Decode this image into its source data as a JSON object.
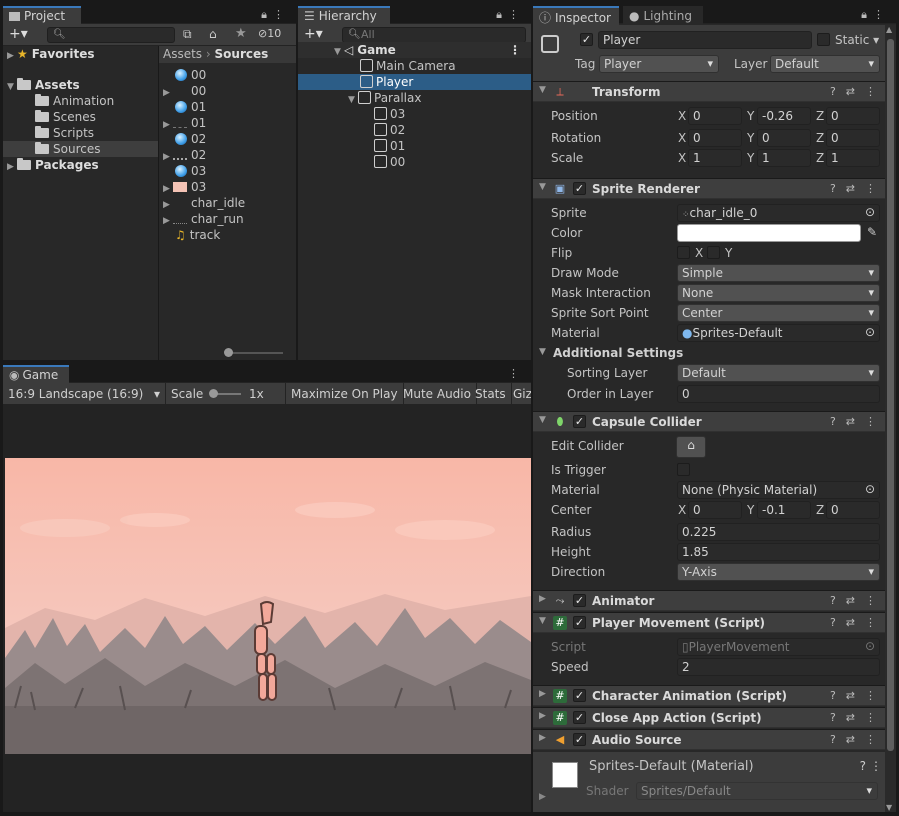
{
  "project": {
    "tab": "Project",
    "hidden_count": "10",
    "tree": [
      {
        "label": "Favorites",
        "kind": "favorites"
      },
      {
        "label": "Assets",
        "kind": "folder-open"
      },
      {
        "label": "Animation",
        "kind": "folder"
      },
      {
        "label": "Scenes",
        "kind": "folder"
      },
      {
        "label": "Scripts",
        "kind": "folder"
      },
      {
        "label": "Sources",
        "kind": "folder"
      },
      {
        "label": "Packages",
        "kind": "folder-root"
      }
    ],
    "breadcrumb": [
      "Assets",
      "Sources"
    ],
    "assets": [
      {
        "label": "00",
        "icon": "sprite-ball"
      },
      {
        "label": "00",
        "icon": "sprite-strip"
      },
      {
        "label": "01",
        "icon": "sprite-ball"
      },
      {
        "label": "01",
        "icon": "sprite-strip"
      },
      {
        "label": "02",
        "icon": "sprite-ball"
      },
      {
        "label": "02",
        "icon": "sprite-strip"
      },
      {
        "label": "03",
        "icon": "sprite-ball"
      },
      {
        "label": "03",
        "icon": "sprite-pink"
      },
      {
        "label": "char_idle",
        "icon": "sprite-char"
      },
      {
        "label": "char_run",
        "icon": "sprite-char"
      },
      {
        "label": "track",
        "icon": "audio-note"
      }
    ]
  },
  "hierarchy": {
    "tab": "Hierarchy",
    "search_placeholder": "All",
    "items": [
      {
        "label": "Game",
        "indent": 0,
        "kind": "scene"
      },
      {
        "label": "Main Camera",
        "indent": 1,
        "kind": "object"
      },
      {
        "label": "Player",
        "indent": 1,
        "kind": "object",
        "selected": true
      },
      {
        "label": "Parallax",
        "indent": 1,
        "kind": "object-parent"
      },
      {
        "label": "03",
        "indent": 2,
        "kind": "object"
      },
      {
        "label": "02",
        "indent": 2,
        "kind": "object"
      },
      {
        "label": "01",
        "indent": 2,
        "kind": "object"
      },
      {
        "label": "00",
        "indent": 2,
        "kind": "object"
      }
    ]
  },
  "game": {
    "tab": "Game",
    "aspect": "16:9 Landscape (16:9)",
    "scale_label": "Scale",
    "scale_value": "1x",
    "maximize": "Maximize On Play",
    "mute": "Mute Audio",
    "stats": "Stats",
    "gizmos": "Giz"
  },
  "inspector": {
    "tab": "Inspector",
    "tab2": "Lighting",
    "object_name": "Player",
    "static_label": "Static",
    "tag_label": "Tag",
    "tag_value": "Player",
    "layer_label": "Layer",
    "layer_value": "Default",
    "transform": {
      "title": "Transform",
      "position_label": "Position",
      "position": [
        "0",
        "-0.26",
        "0"
      ],
      "rotation_label": "Rotation",
      "rotation": [
        "0",
        "0",
        "0"
      ],
      "scale_label": "Scale",
      "scale": [
        "1",
        "1",
        "1"
      ]
    },
    "sprite_renderer": {
      "title": "Sprite Renderer",
      "sprite_label": "Sprite",
      "sprite_value": "char_idle_0",
      "color_label": "Color",
      "color_value": "#ffffff",
      "flip_label": "Flip",
      "flip_x": "X",
      "flip_y": "Y",
      "draw_mode_label": "Draw Mode",
      "draw_mode": "Simple",
      "mask_label": "Mask Interaction",
      "mask": "None",
      "sort_point_label": "Sprite Sort Point",
      "sort_point": "Center",
      "material_label": "Material",
      "material": "Sprites-Default",
      "additional": "Additional Settings",
      "sorting_layer_label": "Sorting Layer",
      "sorting_layer": "Default",
      "order_label": "Order in Layer",
      "order": "0"
    },
    "capsule": {
      "title": "Capsule Collider",
      "edit_label": "Edit Collider",
      "trigger_label": "Is Trigger",
      "material_label": "Material",
      "material": "None (Physic Material)",
      "center_label": "Center",
      "center": [
        "0",
        "-0.1",
        "0"
      ],
      "radius_label": "Radius",
      "radius": "0.225",
      "height_label": "Height",
      "height": "1.85",
      "direction_label": "Direction",
      "direction": "Y-Axis"
    },
    "animator": {
      "title": "Animator"
    },
    "player_movement": {
      "title": "Player Movement (Script)",
      "script_label": "Script",
      "script": "PlayerMovement",
      "speed_label": "Speed",
      "speed": "2"
    },
    "char_anim": {
      "title": "Character Animation (Script)"
    },
    "close_app": {
      "title": "Close App Action (Script)"
    },
    "audio": {
      "title": "Audio Source"
    },
    "material_preview": {
      "name": "Sprites-Default (Material)",
      "shader_label": "Shader",
      "shader": "Sprites/Default"
    },
    "axes": [
      "X",
      "Y",
      "Z"
    ]
  }
}
